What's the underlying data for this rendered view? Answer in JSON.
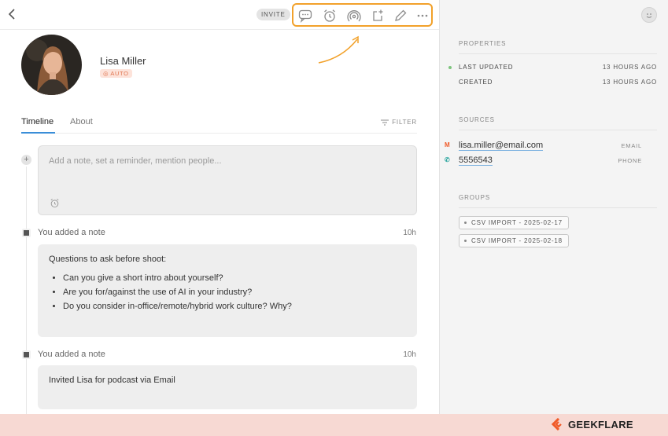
{
  "header": {
    "invite_label": "INVITE"
  },
  "contact": {
    "name": "Lisa Miller",
    "badge": "AUTO"
  },
  "tabs": [
    {
      "label": "Timeline"
    },
    {
      "label": "About"
    }
  ],
  "filter_label": "FILTER",
  "note_input": {
    "placeholder": "Add a note, set a reminder, mention people..."
  },
  "timeline": [
    {
      "title": "You added a note",
      "time": "10h",
      "body": "Questions to ask before shoot:",
      "bullets": [
        "Can you give a short intro about yourself?",
        "Are you for/against the use of AI in your industry?",
        "Do you consider in-office/remote/hybrid work culture? Why?"
      ]
    },
    {
      "title": "You added a note",
      "time": "10h",
      "body": "Invited Lisa for podcast via Email"
    }
  ],
  "sidebar": {
    "properties_heading": "PROPERTIES",
    "properties": [
      {
        "label": "LAST UPDATED",
        "value": "13 HOURS AGO"
      },
      {
        "label": "CREATED",
        "value": "13 HOURS AGO"
      }
    ],
    "sources_heading": "SOURCES",
    "sources": [
      {
        "icon": "M",
        "value": "lisa.miller@email.com",
        "kind": "EMAIL"
      },
      {
        "icon": "phone-icon",
        "value": "5556543",
        "kind": "PHONE"
      }
    ],
    "groups_heading": "GROUPS",
    "groups": [
      "CSV IMPORT - 2025-02-17",
      "CSV IMPORT - 2025-02-18"
    ]
  },
  "brand": {
    "logo_text": "GEEKFLARE"
  },
  "colors": {
    "highlight": "#f2a12a",
    "accent": "#3a8ed8",
    "badge": "#e07550",
    "brand_orange": "#f05a28"
  }
}
